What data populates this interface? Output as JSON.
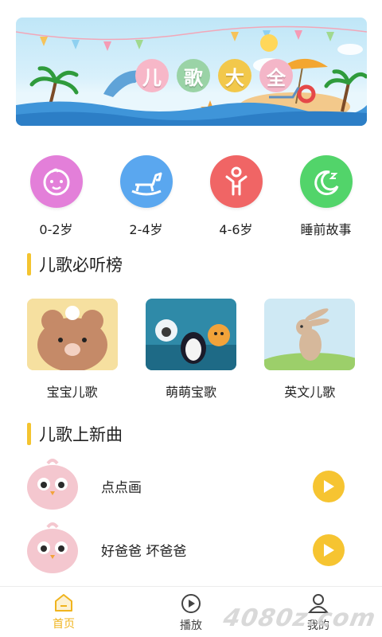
{
  "banner": {
    "title_chars": [
      "儿",
      "歌",
      "大",
      "全"
    ],
    "title_colors": [
      "#f7b7c8",
      "#9ad3a6",
      "#f2c84b",
      "#f4b6c8"
    ]
  },
  "categories": [
    {
      "label": "0-2岁",
      "color": "#e37fd9",
      "icon": "baby-face-icon"
    },
    {
      "label": "2-4岁",
      "color": "#5aa7ef",
      "icon": "rocking-horse-icon"
    },
    {
      "label": "4-6岁",
      "color": "#f06565",
      "icon": "child-icon"
    },
    {
      "label": "睡前故事",
      "color": "#52d46a",
      "icon": "moon-sleep-icon"
    }
  ],
  "section_must_listen": {
    "title": "儿歌必听榜"
  },
  "albums": [
    {
      "label": "宝宝儿歌"
    },
    {
      "label": "萌萌宝歌"
    },
    {
      "label": "英文儿歌"
    }
  ],
  "section_new": {
    "title": "儿歌上新曲"
  },
  "songs": [
    {
      "name": "点点画"
    },
    {
      "name": "好爸爸 坏爸爸"
    }
  ],
  "bottom_nav": [
    {
      "label": "首页",
      "icon": "home-icon",
      "active": true
    },
    {
      "label": "播放",
      "icon": "play-circle-icon",
      "active": false
    },
    {
      "label": "我的",
      "icon": "profile-icon",
      "active": false
    }
  ],
  "colors": {
    "accent": "#f4c430",
    "play_button": "#f6c431",
    "nav_active": "#f0b41e"
  },
  "watermark": "4080z.com"
}
